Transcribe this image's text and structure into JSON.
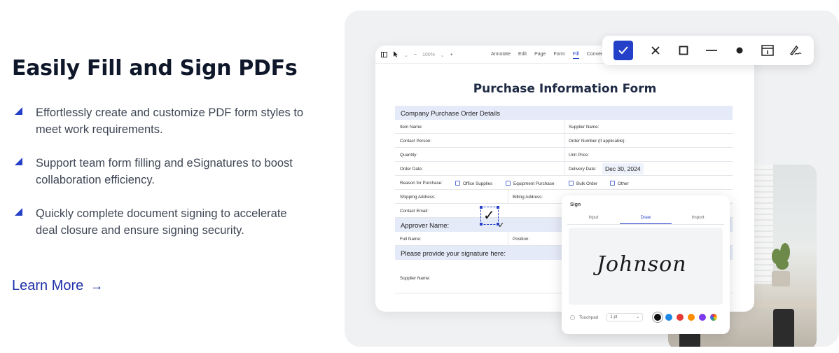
{
  "headline": "Easily Fill and Sign PDFs",
  "features": [
    "Effortlessly create and customize PDF form styles to meet work requirements.",
    "Support team form filling and eSignatures to boost collaboration efficiency.",
    "Quickly complete document signing to accelerate deal closure and ensure signing security."
  ],
  "learn_more": {
    "label": "Learn More",
    "arrow": "→"
  },
  "accent_color": "#2440c8",
  "doc_toolbar": {
    "zoom": "100%",
    "menu": [
      "Annotate",
      "Edit",
      "Page",
      "Form",
      "Fill",
      "Convert"
    ],
    "active_menu": "Fill"
  },
  "form": {
    "title": "Purchase Information Form",
    "section_company": "Company Purchase Order Details",
    "item_name": "Item Name:",
    "supplier_name": "Supplier Name:",
    "contact_person": "Contact Person:",
    "order_number": "Order Number (if applicable):",
    "quantity": "Quantity:",
    "unit_price": "Unit Price:",
    "order_date": "Order Date:",
    "delivery_date": "Delivery Date:",
    "delivery_date_value": "Dec 30, 2024",
    "reason": "Reason for Purchase:",
    "office_supplies": "Office Supplies",
    "equipment_purchase": "Equipment Purchase",
    "bulk_order": "Bulk Order",
    "other": "Other",
    "shipping_address": "Shipping Address:",
    "billing_address": "Billing Address:",
    "contact_email": "Contact Email:",
    "section_approver": "Approver Name:",
    "full_name": "Full Name:",
    "position": "Position:",
    "section_signature": "Please provide your signature here:",
    "supplier_name_sig": "Supplier Name:"
  },
  "float_toolbar": {
    "tools": [
      "check-icon",
      "cross-icon",
      "square-icon",
      "line-icon",
      "dot-icon",
      "date-field-icon",
      "signature-icon"
    ],
    "active_tool": "check-icon"
  },
  "sign_dialog": {
    "title": "Sign",
    "tabs": [
      "Input",
      "Draw",
      "Import"
    ],
    "active_tab": "Draw",
    "signature": "Johnson",
    "input_mode": "Touchpad",
    "thickness": "1 pt",
    "colors": [
      "#111111",
      "#1e88e5",
      "#e53935",
      "#fb8c00",
      "#7c3aed"
    ]
  }
}
